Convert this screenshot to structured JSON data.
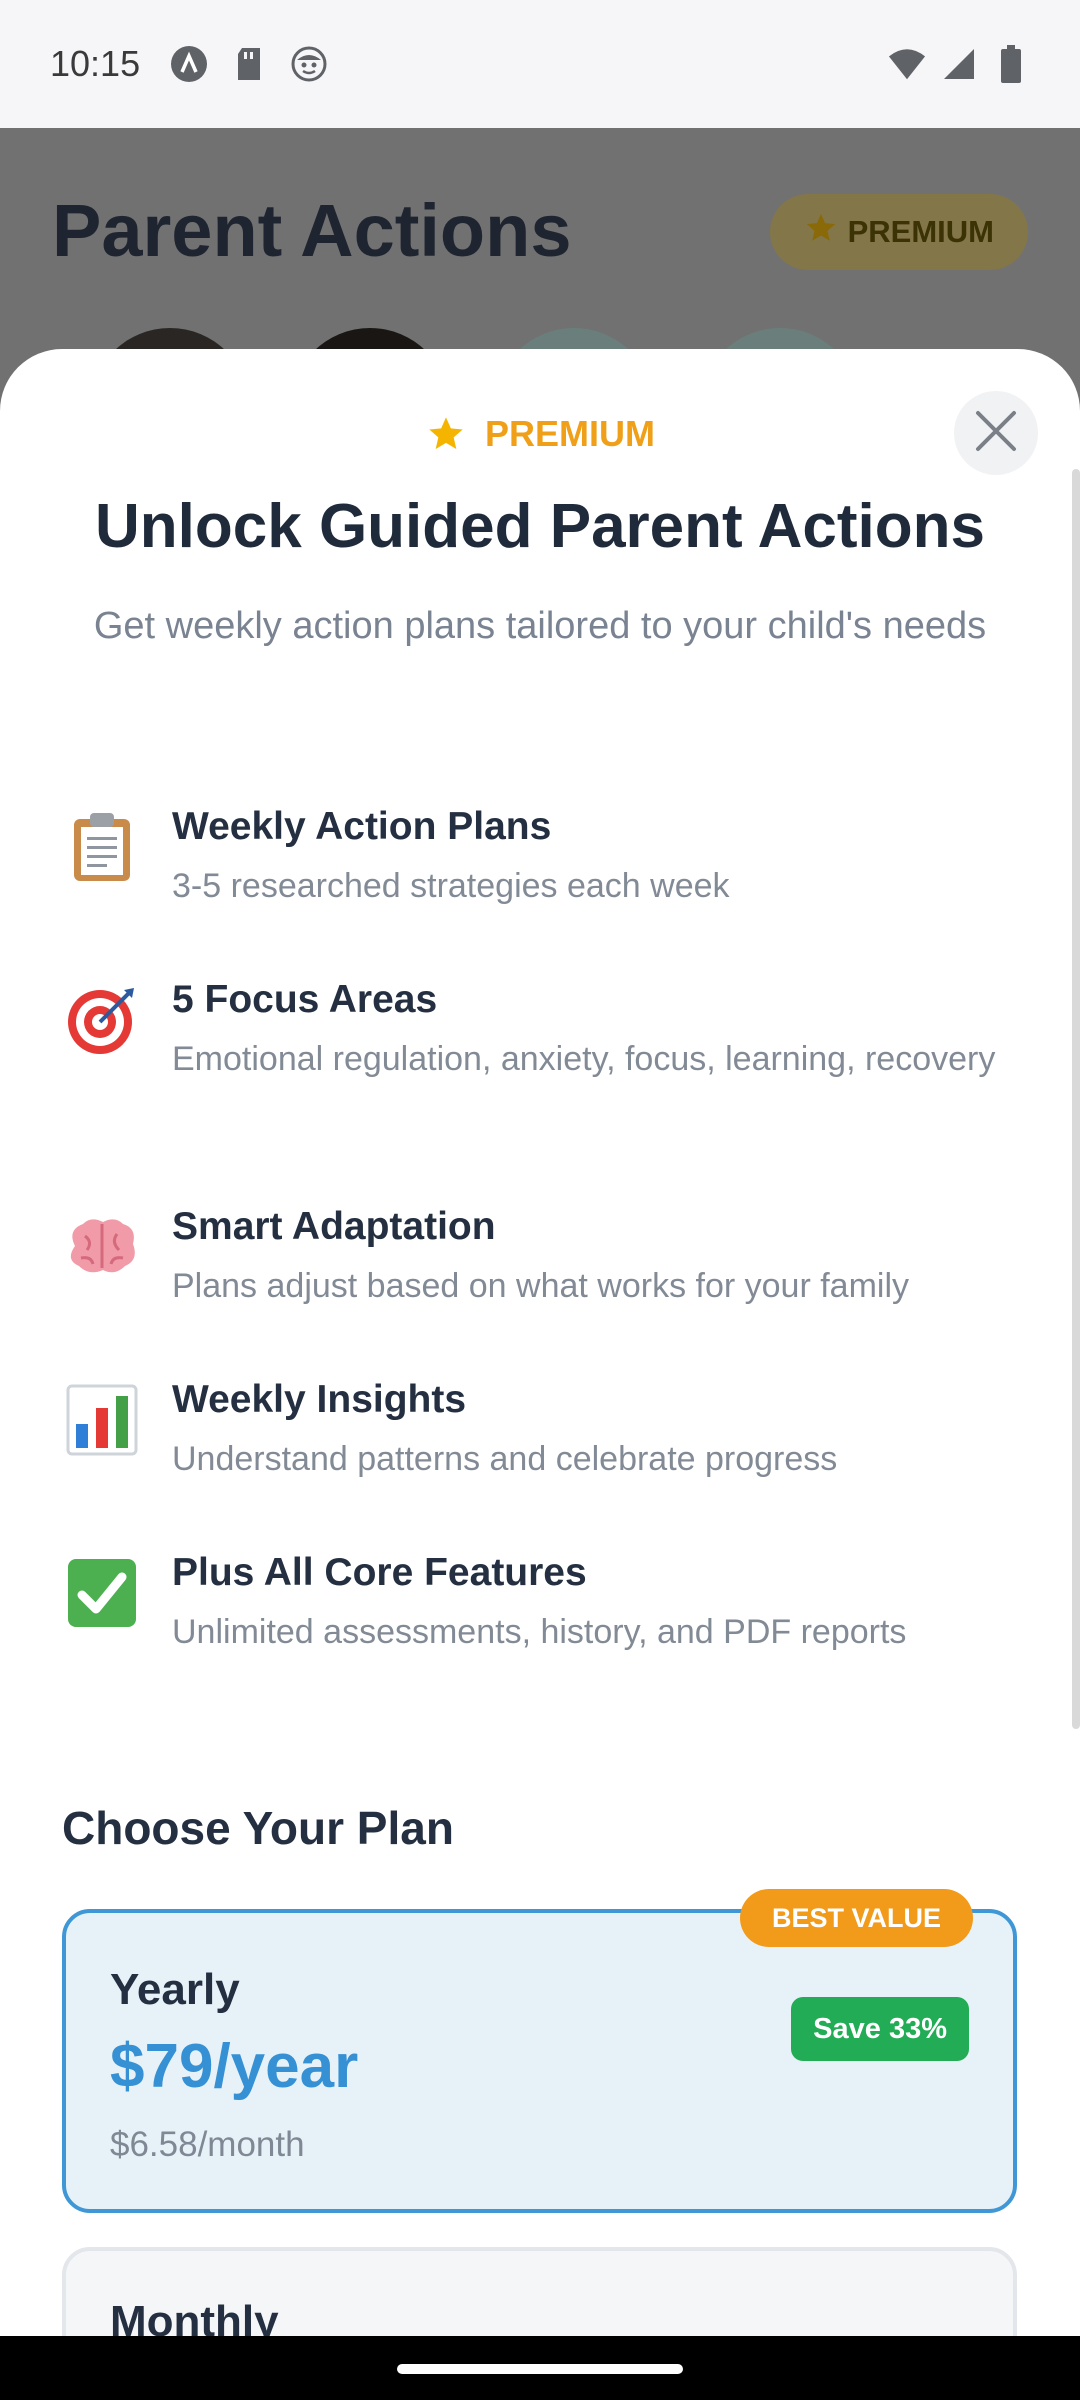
{
  "status_bar": {
    "time": "10:15",
    "left_icons": [
      "a-icon",
      "sd-card-icon",
      "smiley-icon"
    ],
    "right_icons": [
      "wifi-icon",
      "signal-icon",
      "battery-icon"
    ]
  },
  "background": {
    "title": "Parent Actions",
    "premium_badge": "PREMIUM"
  },
  "sheet": {
    "premium_label": "PREMIUM",
    "headline": "Unlock Guided Parent Actions",
    "subheadline": "Get weekly action plans tailored to your child's needs",
    "features": [
      {
        "icon": "clipboard-icon",
        "title": "Weekly Action Plans",
        "description": "3-5 researched strategies each week"
      },
      {
        "icon": "target-icon",
        "title": "5 Focus Areas",
        "description": "Emotional regulation, anxiety, focus, learning, recovery"
      },
      {
        "icon": "brain-icon",
        "title": "Smart Adaptation",
        "description": "Plans adjust based on what works for your family"
      },
      {
        "icon": "bar-chart-icon",
        "title": "Weekly Insights",
        "description": "Understand patterns and celebrate progress"
      },
      {
        "icon": "check-mark-icon",
        "title": "Plus All Core Features",
        "description": "Unlimited assessments, history, and PDF reports"
      }
    ],
    "choose_plan_title": "Choose Your Plan",
    "plans": {
      "yearly": {
        "name": "Yearly",
        "price": "$79/year",
        "per_month": "$6.58/month",
        "badge": "BEST VALUE",
        "save": "Save 33%"
      },
      "monthly": {
        "name": "Monthly"
      }
    }
  },
  "colors": {
    "accent_orange": "#f29a1a",
    "accent_blue": "#3690d4",
    "save_green": "#22ac55",
    "heading": "#243041"
  }
}
